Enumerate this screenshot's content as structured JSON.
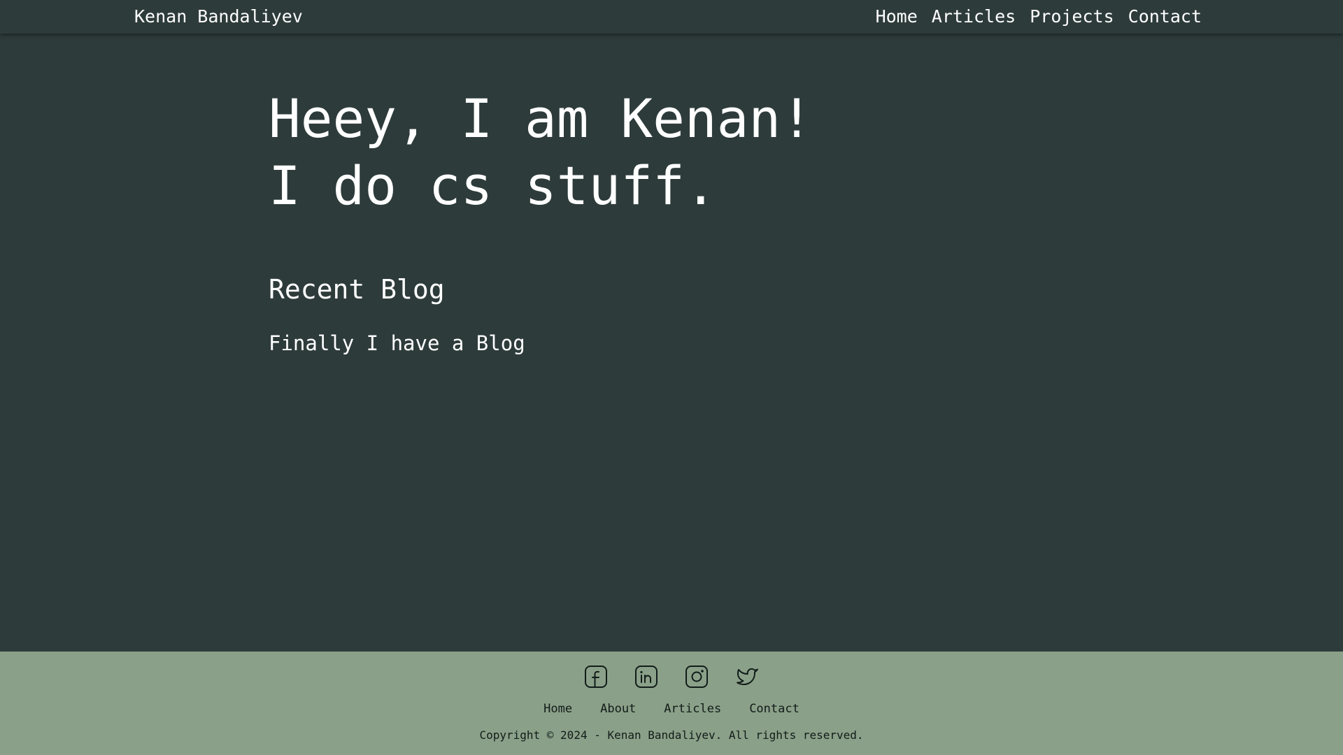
{
  "header": {
    "brand": "Kenan Bandaliyev",
    "nav": [
      {
        "label": "Home"
      },
      {
        "label": "Articles"
      },
      {
        "label": "Projects"
      },
      {
        "label": "Contact"
      }
    ]
  },
  "main": {
    "hero_line1": "Heey, I am Kenan!",
    "hero_line2": "I do cs stuff.",
    "recent_title": "Recent Blog",
    "recent_posts": [
      {
        "title": "Finally I have a Blog"
      }
    ]
  },
  "footer": {
    "social": [
      {
        "icon": "facebook-icon"
      },
      {
        "icon": "linkedin-icon"
      },
      {
        "icon": "instagram-icon"
      },
      {
        "icon": "twitter-icon"
      }
    ],
    "nav": [
      {
        "label": "Home"
      },
      {
        "label": "About"
      },
      {
        "label": "Articles"
      },
      {
        "label": "Contact"
      }
    ],
    "copyright": "Copyright © 2024 - Kenan Bandaliyev. All rights reserved."
  },
  "colors": {
    "background": "#2e3b3b",
    "footer_background": "#8ba088",
    "text": "#ffffff",
    "footer_text": "#111c1a"
  }
}
